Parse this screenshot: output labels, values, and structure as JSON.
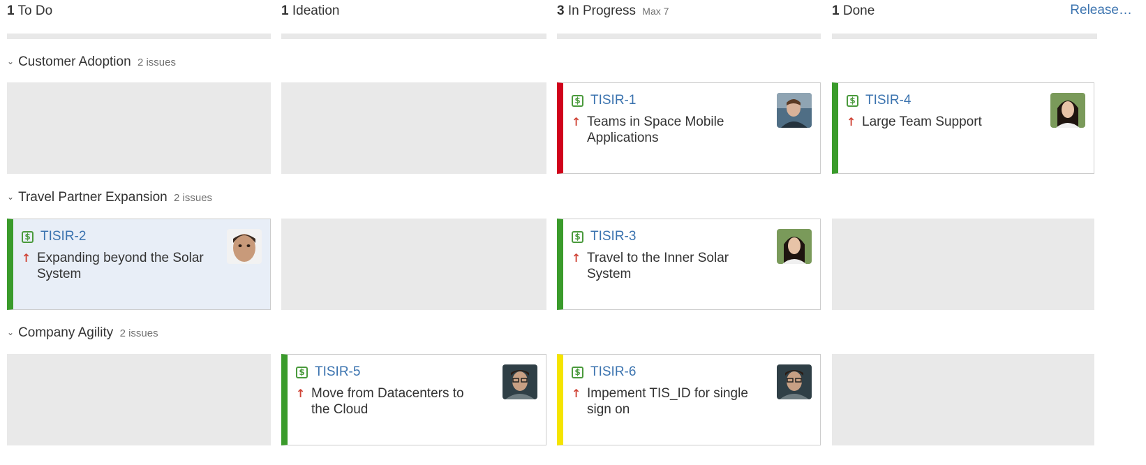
{
  "columns": [
    {
      "count": "1",
      "name": "To Do",
      "max": ""
    },
    {
      "count": "1",
      "name": "Ideation",
      "max": ""
    },
    {
      "count": "3",
      "name": "In Progress",
      "max": "Max 7"
    },
    {
      "count": "1",
      "name": "Done",
      "max": ""
    }
  ],
  "release_label": "Release…",
  "swimlanes": [
    {
      "name": "Customer Adoption",
      "issues": "2 issues"
    },
    {
      "name": "Travel Partner Expansion",
      "issues": "2 issues"
    },
    {
      "name": "Company Agility",
      "issues": "2 issues"
    }
  ],
  "cards": {
    "tisir1": {
      "key": "TISIR-1",
      "summary": "Teams in Space Mobile Applications",
      "status_color": "#d0021b",
      "type_icon": "dollar-icon",
      "priority_icon": "arrow-up-icon"
    },
    "tisir4": {
      "key": "TISIR-4",
      "summary": "Large Team Support",
      "status_color": "#3a9b2b",
      "type_icon": "dollar-icon",
      "priority_icon": "arrow-up-icon"
    },
    "tisir2": {
      "key": "TISIR-2",
      "summary": "Expanding beyond the Solar System",
      "status_color": "#3a9b2b",
      "type_icon": "dollar-icon",
      "priority_icon": "arrow-up-icon"
    },
    "tisir3": {
      "key": "TISIR-3",
      "summary": "Travel to the Inner Solar System",
      "status_color": "#3a9b2b",
      "type_icon": "dollar-icon",
      "priority_icon": "arrow-up-icon"
    },
    "tisir5": {
      "key": "TISIR-5",
      "summary": "Move from Datacenters to the Cloud",
      "status_color": "#3a9b2b",
      "type_icon": "dollar-icon",
      "priority_icon": "arrow-up-icon"
    },
    "tisir6": {
      "key": "TISIR-6",
      "summary": "Impement TIS_ID for single sign on",
      "status_color": "#f5e400",
      "type_icon": "dollar-icon",
      "priority_icon": "arrow-up-icon"
    }
  },
  "icons": {
    "dollar_glyph": "$",
    "arrow_glyph": "↑",
    "chevron_glyph": "⌄"
  },
  "colors": {
    "link": "#3b73af",
    "priority": "#d04437",
    "type_icon": "#4a9a3c",
    "empty_cell": "#e9e9e9",
    "selected_card": "#e8eef7"
  }
}
